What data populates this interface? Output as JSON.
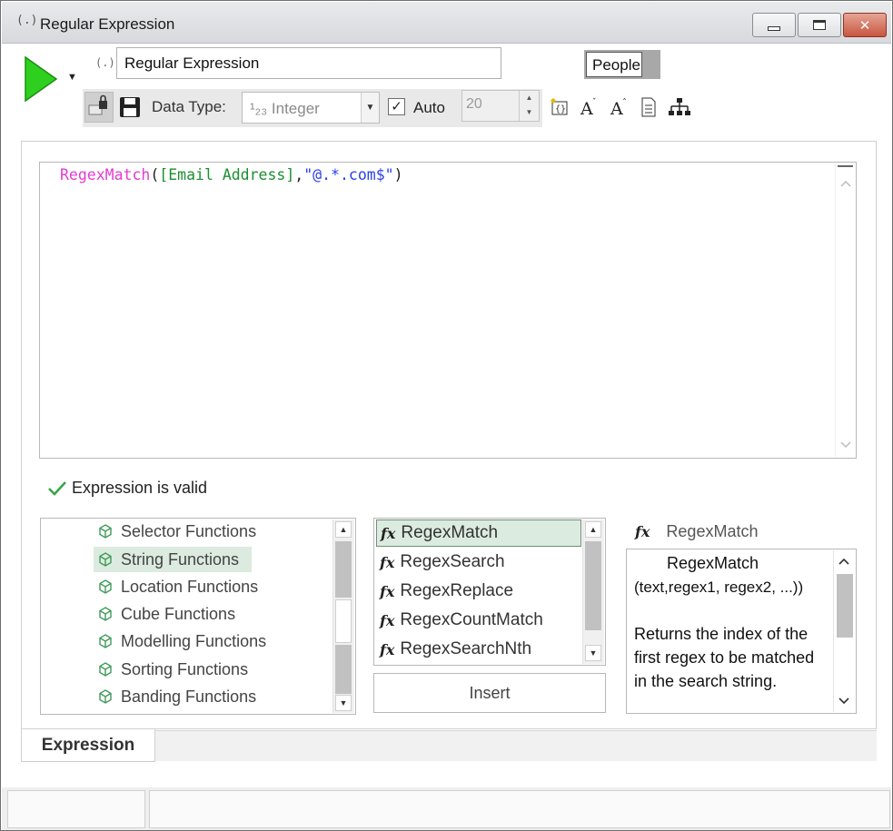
{
  "window": {
    "title": "Regular Expression",
    "title_icon": "(.)"
  },
  "header": {
    "name_icon": "(.)",
    "name_value": "Regular Expression",
    "tag_label": "People"
  },
  "toolbar": {
    "data_type_label": "Data Type:",
    "data_type_value": "¹₂₃ Integer",
    "auto_label": "Auto",
    "auto_checked": true,
    "spin_value": "20",
    "icons": [
      "lock-icon",
      "save-icon",
      "insert-field-icon",
      "font-decrease-icon",
      "font-increase-icon",
      "document-icon",
      "hierarchy-icon"
    ]
  },
  "editor": {
    "tokens": {
      "fn": "RegexMatch",
      "open": "(",
      "field": "[Email Address]",
      "comma": ",",
      "str": "\"@.*.com$\"",
      "close": ")"
    }
  },
  "validation": {
    "message": "Expression is valid"
  },
  "categories": {
    "items": [
      "Selector Functions",
      "String Functions",
      "Location Functions",
      "Cube Functions",
      "Modelling Functions",
      "Sorting Functions",
      "Banding Functions"
    ],
    "selected": "String Functions"
  },
  "functions": {
    "items": [
      "RegexMatch",
      "RegexSearch",
      "RegexReplace",
      "RegexCountMatch",
      "RegexSearchNth"
    ],
    "selected": "RegexMatch",
    "fx_symbol": "fx",
    "insert_label": "Insert"
  },
  "help": {
    "header_title": "RegexMatch",
    "name": "RegexMatch",
    "signature": "(text,regex1, regex2, ...))",
    "description": "Returns the index of the first regex to be matched in the search string."
  },
  "tabs": {
    "active": "Expression"
  },
  "colors": {
    "function_token": "#e33bd3",
    "field_token": "#1b8f2f",
    "string_token": "#2a3ee8",
    "selection_bg": "#dcebdf",
    "run_green": "#2fcf1f",
    "valid_check": "#3aa54a",
    "close_button": "#c7553f"
  }
}
